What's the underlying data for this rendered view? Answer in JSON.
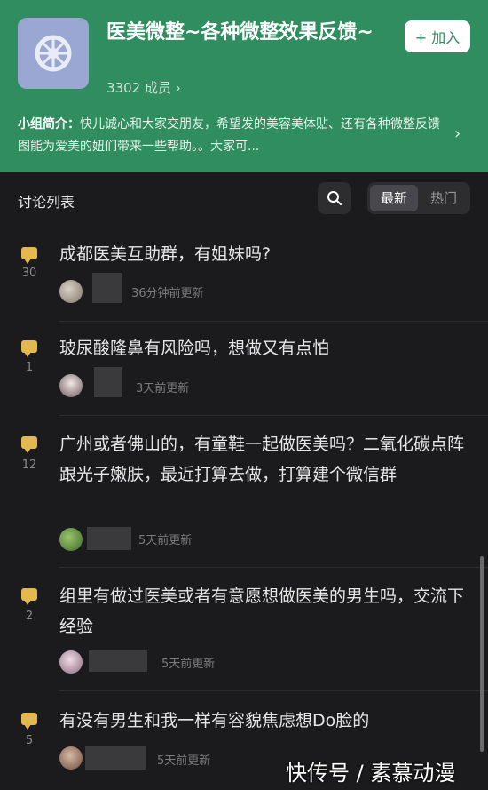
{
  "group": {
    "title": "医美微整~各种微整效果反馈~",
    "members": "3302 成员 ›",
    "join_label": "+ 加入",
    "intro_label": "小组简介：",
    "intro_text": "快儿诚心和大家交朋友，希望发的美容美体贴、还有各种微整反馈图能为爱美的妞们带来一些帮助。。大家可...",
    "intro_chevron": "›"
  },
  "list": {
    "title": "讨论列表",
    "sort_new": "最新",
    "sort_hot": "热门"
  },
  "posts": [
    {
      "count": "30",
      "text": "成都医美互助群，有姐妹吗?",
      "time": "36分钟前更新"
    },
    {
      "count": "1",
      "text": "玻尿酸隆鼻有风险吗，想做又有点怕",
      "time": "3天前更新"
    },
    {
      "count": "12",
      "text": "广州或者佛山的，有童鞋一起做医美吗？二氧化碳点阵跟光子嫩肤，最近打算去做，打算建个微信群",
      "time": "5天前更新"
    },
    {
      "count": "2",
      "text": "组里有做过医美或者有意愿想做医美的男生吗，交流下经验",
      "time": "5天前更新"
    },
    {
      "count": "5",
      "text": "有没有男生和我一样有容貌焦虑想Do脸的",
      "time": "5天前更新"
    }
  ],
  "watermark": "快传号 / 素慕动漫",
  "colors": {
    "header": "#2f8d5f",
    "accent": "#e3b84f",
    "background": "#1b1b1d"
  },
  "icons": {
    "search": "search-icon",
    "comment": "comment-bubble-icon"
  }
}
